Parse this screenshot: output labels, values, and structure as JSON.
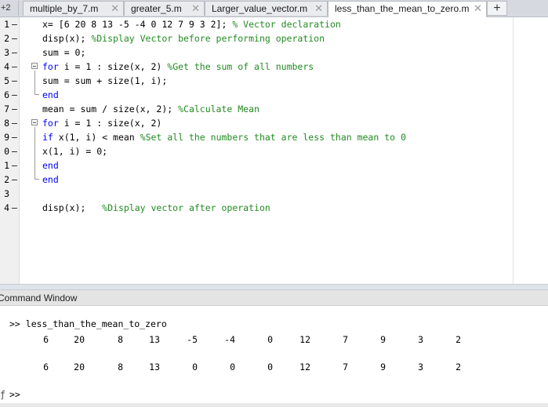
{
  "tabs": {
    "overflow_label": "+2",
    "items": [
      {
        "label": "multiple_by_7.m",
        "close": "✕"
      },
      {
        "label": "greater_5.m",
        "close": "✕"
      },
      {
        "label": "Larger_value_vector.m",
        "close": "✕"
      },
      {
        "label": "less_than_the_mean_to_zero.m",
        "close": "✕"
      }
    ],
    "add_label": "+"
  },
  "editor": {
    "lines": [
      {
        "num": "1",
        "code": "x= [6 20 8 13 -5 -4 0 12 7 9 3 2]; ",
        "comment": "% Vector declaration"
      },
      {
        "num": "2",
        "code": "disp(x); ",
        "comment": "%Display Vector before performing operation"
      },
      {
        "num": "3",
        "code": "sum = 0;",
        "comment": ""
      },
      {
        "num": "4",
        "kw": "for",
        "code": " i = 1 : size(x, 2) ",
        "comment": "%Get the sum of all numbers"
      },
      {
        "num": "5",
        "code": "sum = sum + size(1, i);",
        "comment": ""
      },
      {
        "num": "6",
        "kw": "end",
        "code": "",
        "comment": ""
      },
      {
        "num": "7",
        "code": "mean = sum / size(x, 2); ",
        "comment": "%Calculate Mean"
      },
      {
        "num": "8",
        "kw": "for",
        "code": " i = 1 : size(x, 2)",
        "comment": ""
      },
      {
        "num": "9",
        "kw": "if",
        "code": " x(1, i) < mean ",
        "comment": "%Set all the numbers that are less than mean to 0"
      },
      {
        "num": "0",
        "code": "x(1, i) = 0;",
        "comment": ""
      },
      {
        "num": "1",
        "kw": "end",
        "code": "",
        "comment": ""
      },
      {
        "num": "2",
        "kw": "end",
        "code": "",
        "comment": ""
      },
      {
        "num": "3",
        "code": "",
        "comment": ""
      },
      {
        "num": "4",
        "code": "disp(x);   ",
        "comment": "%Display vector after operation"
      }
    ],
    "dash": "–"
  },
  "command_window": {
    "title": "Command Window",
    "command": ">> less_than_the_mean_to_zero",
    "output_row1": [
      "6",
      "20",
      "8",
      "13",
      "-5",
      "-4",
      "0",
      "12",
      "7",
      "9",
      "3",
      "2"
    ],
    "output_row2": [
      "6",
      "20",
      "8",
      "13",
      "0",
      "0",
      "0",
      "12",
      "7",
      "9",
      "3",
      "2"
    ],
    "prompt": ">>",
    "prompt_marker": "ƒ"
  }
}
